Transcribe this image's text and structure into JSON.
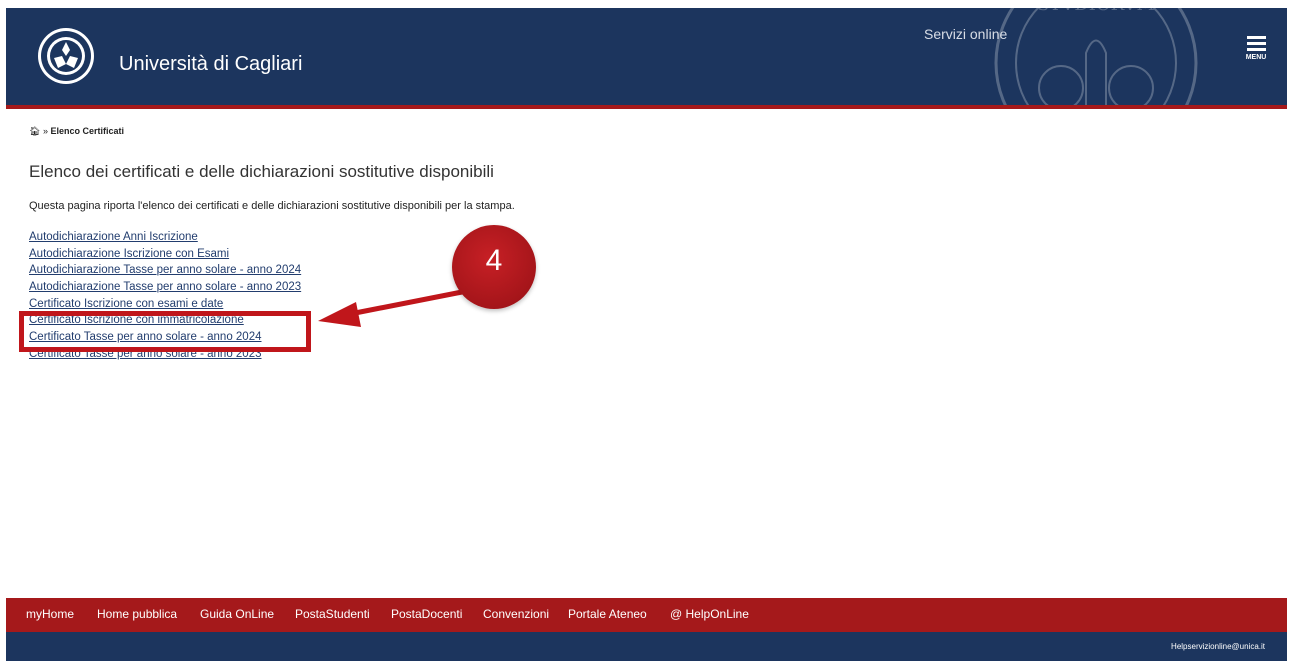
{
  "header": {
    "university_name": "Università di Cagliari",
    "section_label": "Servizi online",
    "menu_label": "MENU",
    "seal_text": "STVDIORVM"
  },
  "breadcrumb": {
    "separator": "»",
    "current": "Elenco Certificati"
  },
  "main": {
    "title": "Elenco dei certificati e delle dichiarazioni sostitutive disponibili",
    "intro": "Questa pagina riporta l'elenco dei certificati e delle dichiarazioni sostitutive disponibili per la stampa.",
    "certificates": [
      "Autodichiarazione Anni Iscrizione ",
      "Autodichiarazione Iscrizione con Esami",
      "Autodichiarazione Tasse per anno solare - anno 2024",
      "Autodichiarazione Tasse per anno solare - anno 2023",
      "Certificato Iscrizione con esami e date",
      "Certificato Iscrizione con immatricolazione",
      "Certificato Tasse per anno solare - anno 2024",
      "Certificato Tasse per anno solare - anno 2023"
    ]
  },
  "annotation": {
    "step_number": "4",
    "color": "#c0161b"
  },
  "footer": {
    "links": [
      "myHome",
      "Home pubblica",
      "Guida OnLine",
      "PostaStudenti",
      "PostaDocenti",
      "Convenzioni",
      "Portale Ateneo",
      "@ HelpOnLine"
    ],
    "email": "Helpservizionline@unica.it"
  },
  "colors": {
    "header_blue": "#1c355e",
    "accent_red": "#a5191b",
    "link_blue": "#223d6e"
  }
}
